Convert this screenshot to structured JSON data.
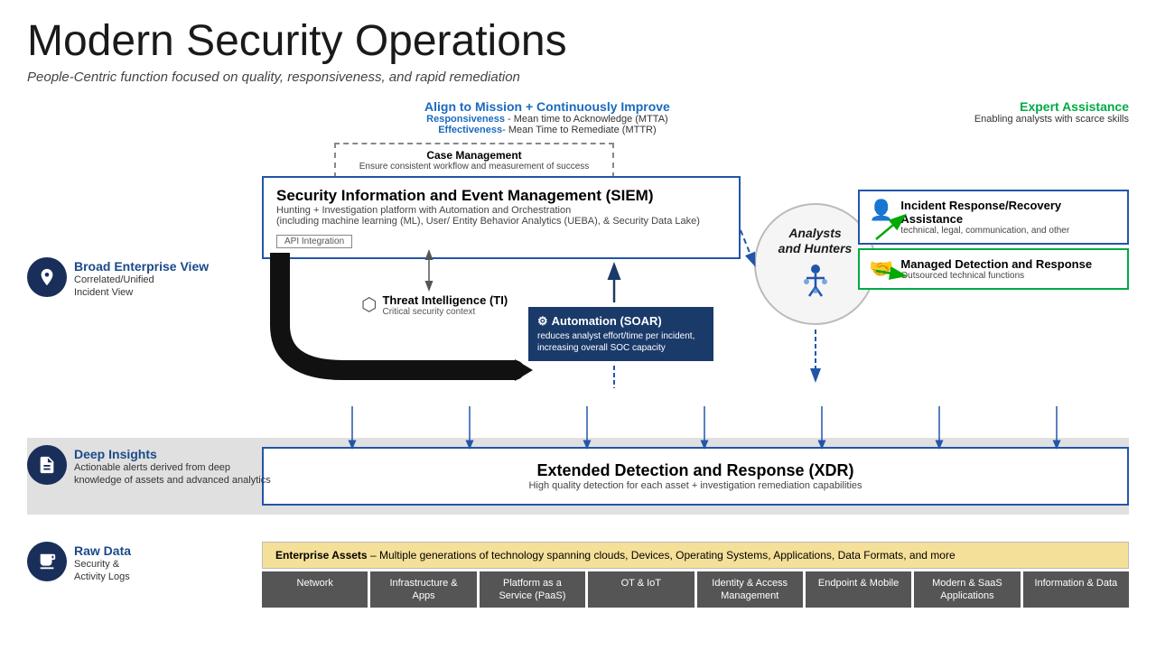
{
  "page": {
    "title": "Modern Security Operations",
    "subtitle": "People-Centric function focused on quality, responsiveness,  and rapid remediation"
  },
  "left_labels": {
    "broad": {
      "title": "Broad Enterprise View",
      "sub1": "Correlated/Unified",
      "sub2": "Incident View"
    },
    "deep": {
      "title": "Deep Insights",
      "sub1": "Actionable alerts derived from deep",
      "sub2": "knowledge of assets and advanced analytics"
    },
    "raw": {
      "title": "Raw Data",
      "sub1": "Security &",
      "sub2": "Activity Logs"
    }
  },
  "align": {
    "title": "Align to Mission + Continuously Improve",
    "line1_bold": "Responsiveness",
    "line1_rest": " - Mean time to Acknowledge (MTTA)",
    "line2_bold": "Effectiveness",
    "line2_rest": "- Mean Time to Remediate (MTTR)"
  },
  "expert": {
    "title": "Expert Assistance",
    "sub": "Enabling analysts with scarce skills"
  },
  "case_mgmt": {
    "title": "Case Management",
    "sub": "Ensure consistent workflow and measurement of success"
  },
  "siem": {
    "title": "Security Information and Event Management (SIEM)",
    "sub1": "Hunting + Investigation platform with Automation and Orchestration",
    "sub2": "(including machine learning (ML), User/ Entity Behavior Analytics (UEBA), & Security Data Lake)",
    "api": "API Integration"
  },
  "ti": {
    "title": "Threat Intelligence (TI)",
    "sub": "Critical security context"
  },
  "soar": {
    "title": "Automation (SOAR)",
    "sub": "reduces analyst effort/time per incident, increasing overall SOC capacity"
  },
  "analysts": {
    "title1": "Analysts",
    "title2": "and Hunters"
  },
  "ir": {
    "title": "Incident Response/Recovery Assistance",
    "sub": "technical, legal, communication, and other"
  },
  "mdr": {
    "title": "Managed  Detection and Response",
    "sub": "Outsourced technical functions"
  },
  "xdr": {
    "title": "Extended Detection and Response (XDR)",
    "sub": "High quality detection for each asset + investigation remediation capabilities"
  },
  "enterprise": {
    "header_bold": "Enterprise Assets",
    "header_rest": " – Multiple generations of technology spanning clouds, Devices, Operating Systems, Applications, Data Formats, and more"
  },
  "asset_tags": [
    "Network",
    "Infrastructure & Apps",
    "Platform as a Service (PaaS)",
    "OT & IoT",
    "Identity & Access Management",
    "Endpoint & Mobile",
    "Modern & SaaS Applications",
    "Information & Data"
  ]
}
